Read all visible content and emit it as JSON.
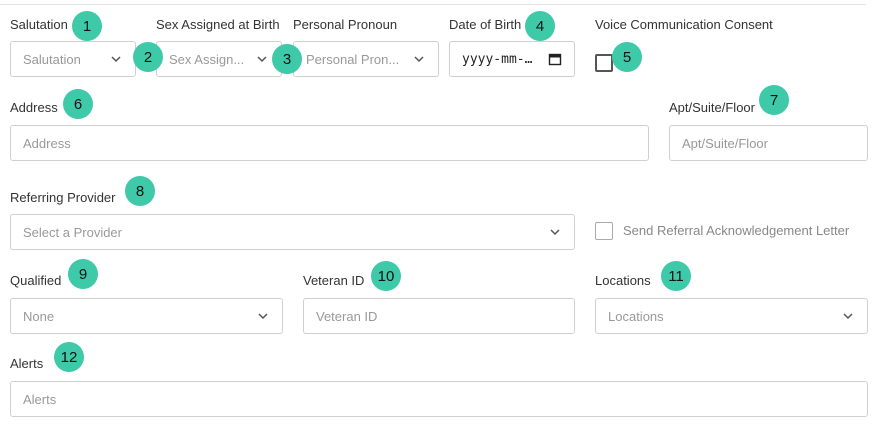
{
  "fields": {
    "salutation": {
      "label": "Salutation",
      "placeholder": "Salutation"
    },
    "sex_assigned": {
      "label": "Sex Assigned at Birth",
      "placeholder": "Sex Assign..."
    },
    "pronoun": {
      "label": "Personal Pronoun",
      "placeholder": "Personal Pron..."
    },
    "dob": {
      "label": "Date of Birth",
      "placeholder": "yyyy-mm-dd"
    },
    "voice_consent": {
      "label": "Voice Communication Consent",
      "checked": false
    },
    "address": {
      "label": "Address",
      "placeholder": "Address"
    },
    "apt": {
      "label": "Apt/Suite/Floor",
      "placeholder": "Apt/Suite/Floor"
    },
    "referring_provider": {
      "label": "Referring Provider",
      "placeholder": "Select a Provider"
    },
    "referral_letter": {
      "label": "Send Referral Acknowledgement Letter",
      "checked": false
    },
    "qualified": {
      "label": "Qualified",
      "value": "None"
    },
    "veteran_id": {
      "label": "Veteran ID",
      "placeholder": "Veteran ID"
    },
    "locations": {
      "label": "Locations",
      "placeholder": "Locations"
    },
    "alerts": {
      "label": "Alerts",
      "placeholder": "Alerts"
    }
  },
  "markers": [
    "1",
    "2",
    "3",
    "4",
    "5",
    "6",
    "7",
    "8",
    "9",
    "10",
    "11",
    "12"
  ],
  "colors": {
    "marker": "#3ec9a8",
    "border": "#cfcfcf",
    "placeholder": "#999999"
  }
}
